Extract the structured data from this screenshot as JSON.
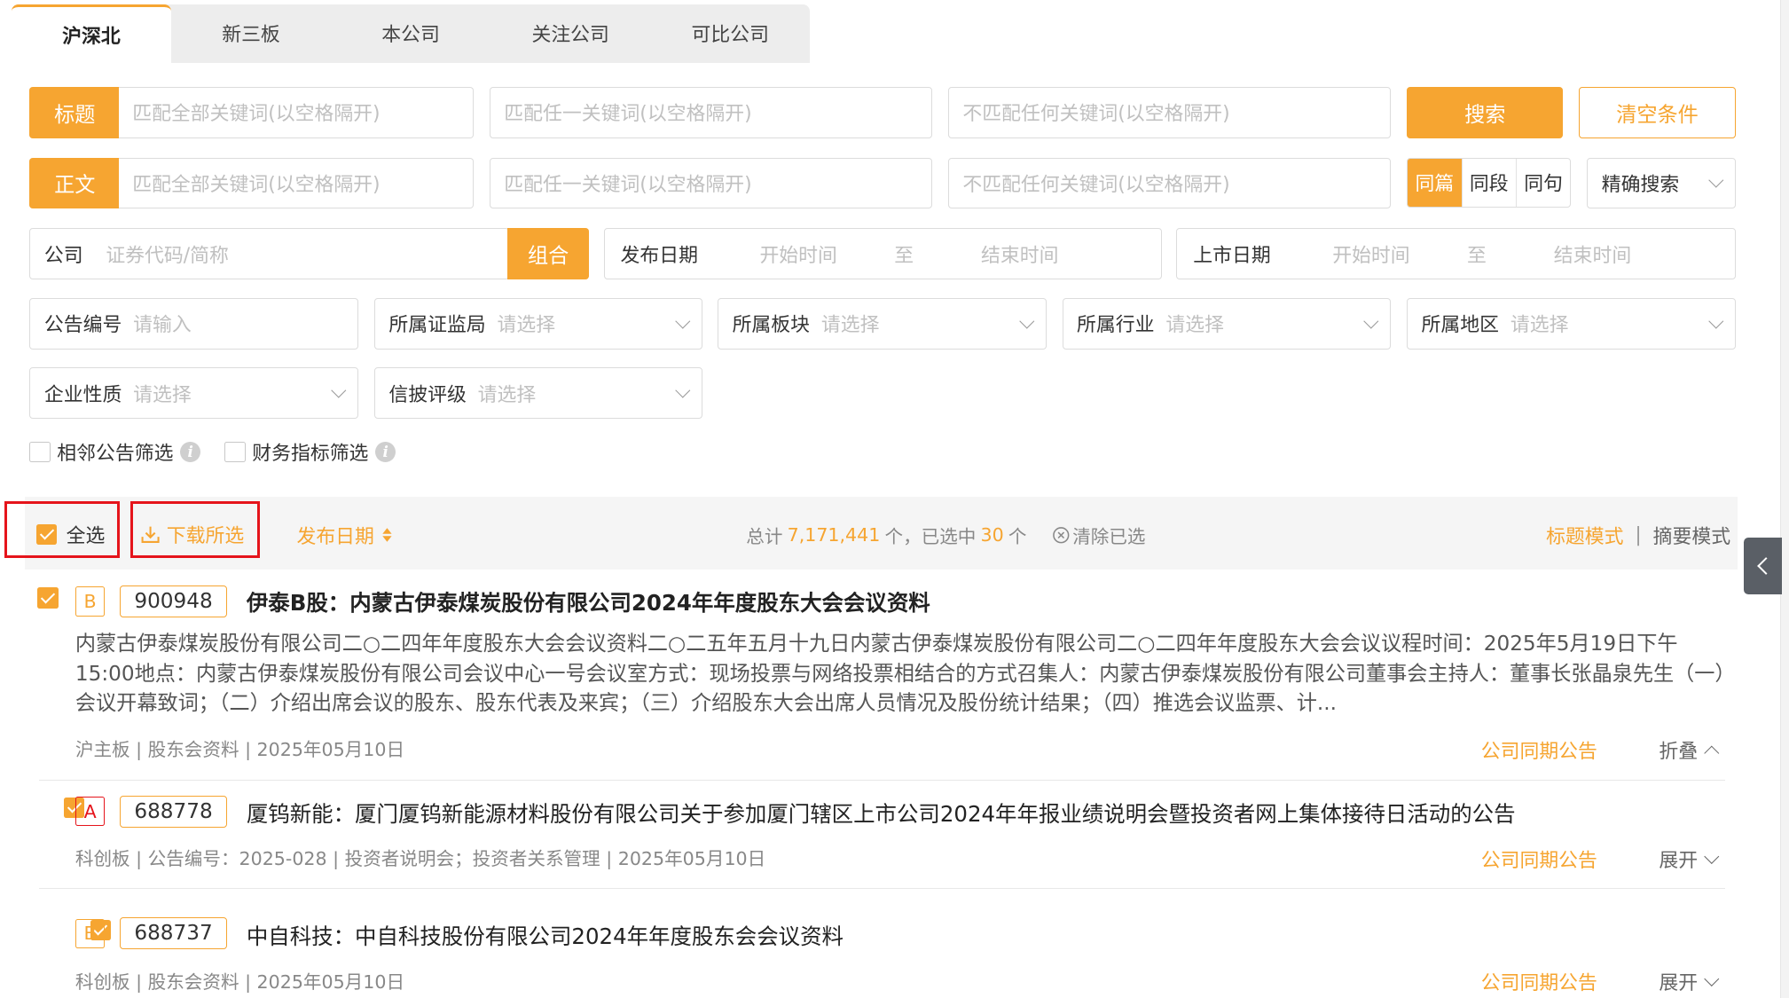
{
  "tabs": [
    "沪深北",
    "新三板",
    "本公司",
    "关注公司",
    "可比公司"
  ],
  "search": {
    "title_label": "标题",
    "body_label": "正文",
    "all_keywords_placeholder": "匹配全部关键词(以空格隔开)",
    "any_keyword_placeholder": "匹配任一关键词(以空格隔开)",
    "none_keyword_placeholder": "不匹配任何关键词(以空格隔开)",
    "search_button": "搜索",
    "clear_button": "清空条件",
    "scope_options": [
      "同篇",
      "同段",
      "同句"
    ],
    "match_mode": "精确搜索",
    "company_label": "公司",
    "company_placeholder": "证券代码/简称",
    "combine_button": "组合",
    "publish_date_label": "发布日期",
    "listing_date_label": "上市日期",
    "start_placeholder": "开始时间",
    "to_text": "至",
    "end_placeholder": "结束时间",
    "notice_no_label": "公告编号",
    "notice_no_placeholder": "请输入",
    "select_placeholder": "请选择",
    "regulator_label": "所属证监局",
    "sector_label": "所属板块",
    "industry_label": "所属行业",
    "region_label": "所属地区",
    "enterprise_label": "企业性质",
    "disclosure_label": "信披评级",
    "adjacent_filter": "相邻公告筛选",
    "financial_filter": "财务指标筛选"
  },
  "toolbar": {
    "select_all": "全选",
    "download_selected": "下载所选",
    "sort_by": "发布日期",
    "total_prefix": "总计",
    "total_count": "7,171,441",
    "total_unit": "个，已选中",
    "selected_count": "30",
    "selected_unit": "个",
    "clear_selected": "清除已选",
    "title_mode": "标题模式",
    "separator": "|",
    "summary_mode": "摘要模式"
  },
  "results": [
    {
      "badge": "B",
      "code": "900948",
      "title": "伊泰B股：内蒙古伊泰煤炭股份有限公司2024年年度股东大会会议资料",
      "summary": "内蒙古伊泰煤炭股份有限公司二○二四年年度股东大会会议资料二○二五年五月十九日内蒙古伊泰煤炭股份有限公司二○二四年年度股东大会会议议程时间：2025年5月19日下午15:00地点：内蒙古伊泰煤炭股份有限公司会议中心一号会议室方式：现场投票与网络投票相结合的方式召集人：内蒙古伊泰煤炭股份有限公司董事会主持人：董事长张晶泉先生（一）会议开幕致词；（二）介绍出席会议的股东、股东代表及来宾；（三）介绍股东大会出席人员情况及股份统计结果；（四）推选会议监票、计...",
      "meta": "沪主板 | 股东会资料 | 2025年05月10日",
      "related": "公司同期公告",
      "toggle": "折叠"
    },
    {
      "badge": "A",
      "code": "688778",
      "title": "厦钨新能：厦门厦钨新能源材料股份有限公司关于参加厦门辖区上市公司2024年年报业绩说明会暨投资者网上集体接待日活动的公告",
      "meta": "科创板 | 公告编号：2025-028 | 投资者说明会；投资者关系管理 | 2025年05月10日",
      "related": "公司同期公告",
      "toggle": "展开"
    },
    {
      "badge": "B",
      "code": "688737",
      "title": "中自科技：中自科技股份有限公司2024年年度股东会会议资料",
      "meta": "科创板 | 股东会资料 | 2025年05月10日",
      "related": "公司同期公告",
      "toggle": "展开"
    }
  ],
  "colors": {
    "accent": "#f6a531",
    "highlight": "#e5141b"
  }
}
